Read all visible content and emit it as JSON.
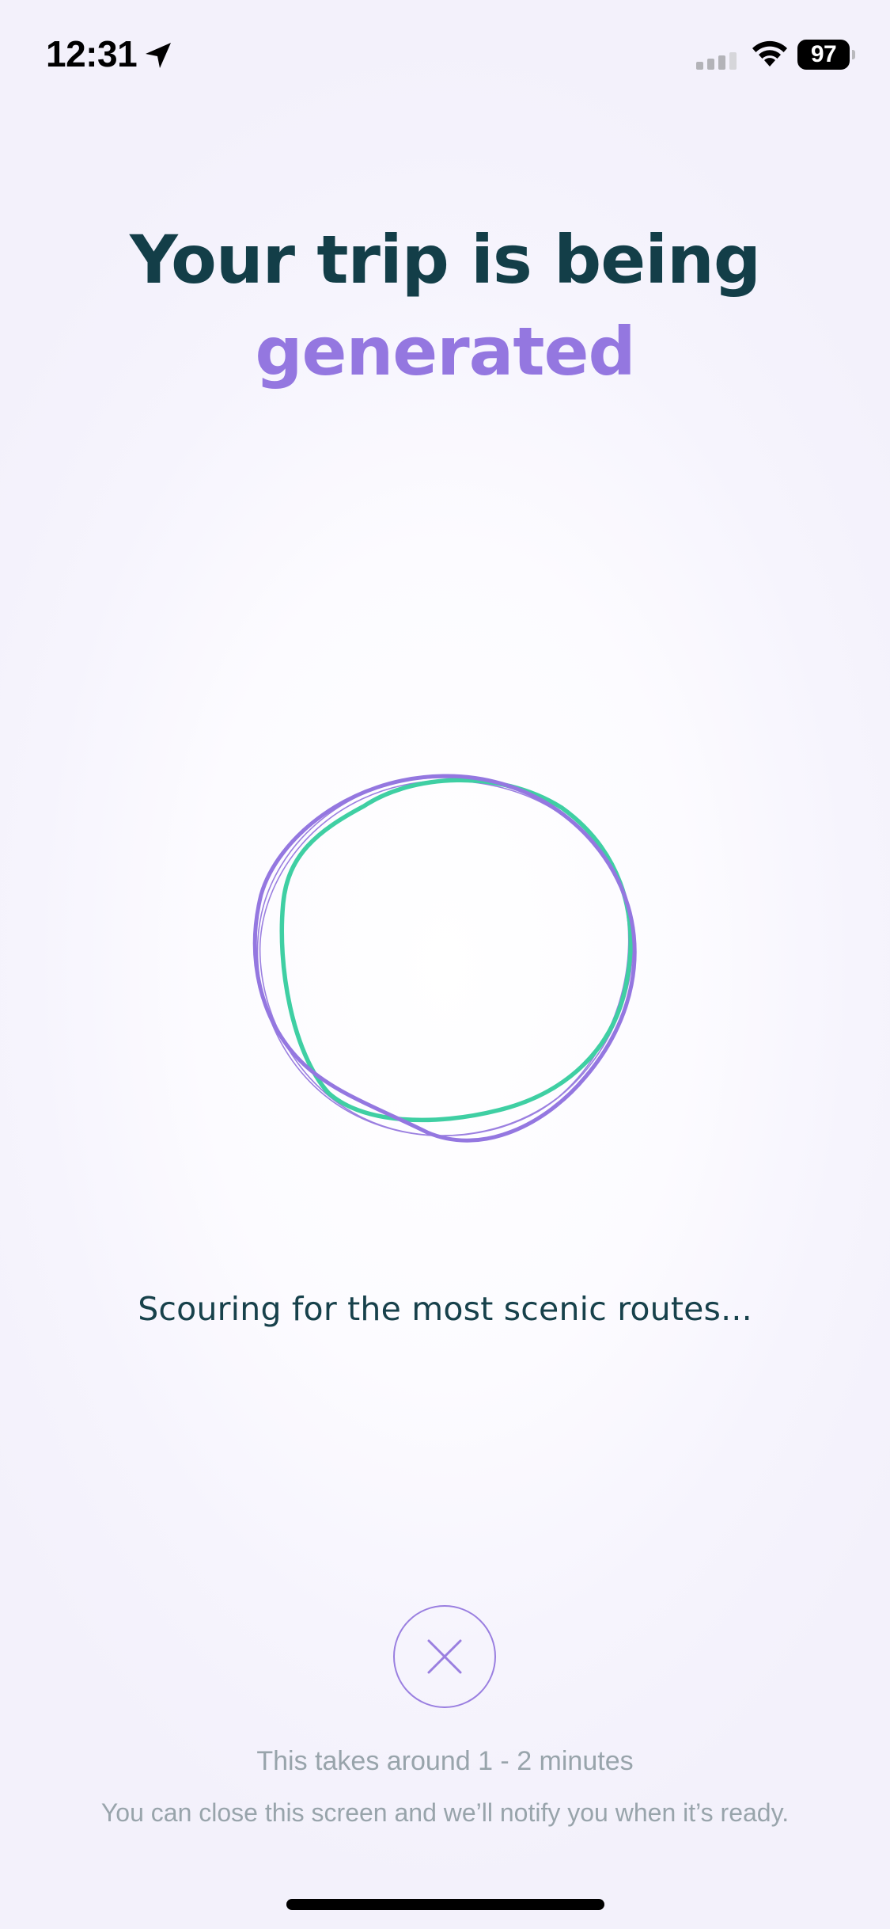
{
  "status_bar": {
    "time": "12:31",
    "battery_level": "97",
    "icons": [
      "location-arrow-icon",
      "cellular-signal-icon",
      "wifi-icon",
      "battery-icon"
    ]
  },
  "headline": {
    "line1": "Your trip is being",
    "line2": "generated"
  },
  "loader": {
    "icon": "loading-rings"
  },
  "status_message": "Scouring for the most scenic routes...",
  "cancel": {
    "icon": "close-icon"
  },
  "footer": {
    "duration_note": "This takes around 1 - 2 minutes",
    "notify_note": "You can close this screen and we’ll notify you when it’s ready."
  },
  "colors": {
    "heading_dark": "#133e48",
    "accent_purple": "#9477e0",
    "accent_teal": "#3fcfa3",
    "muted_text": "#98a4ab"
  }
}
